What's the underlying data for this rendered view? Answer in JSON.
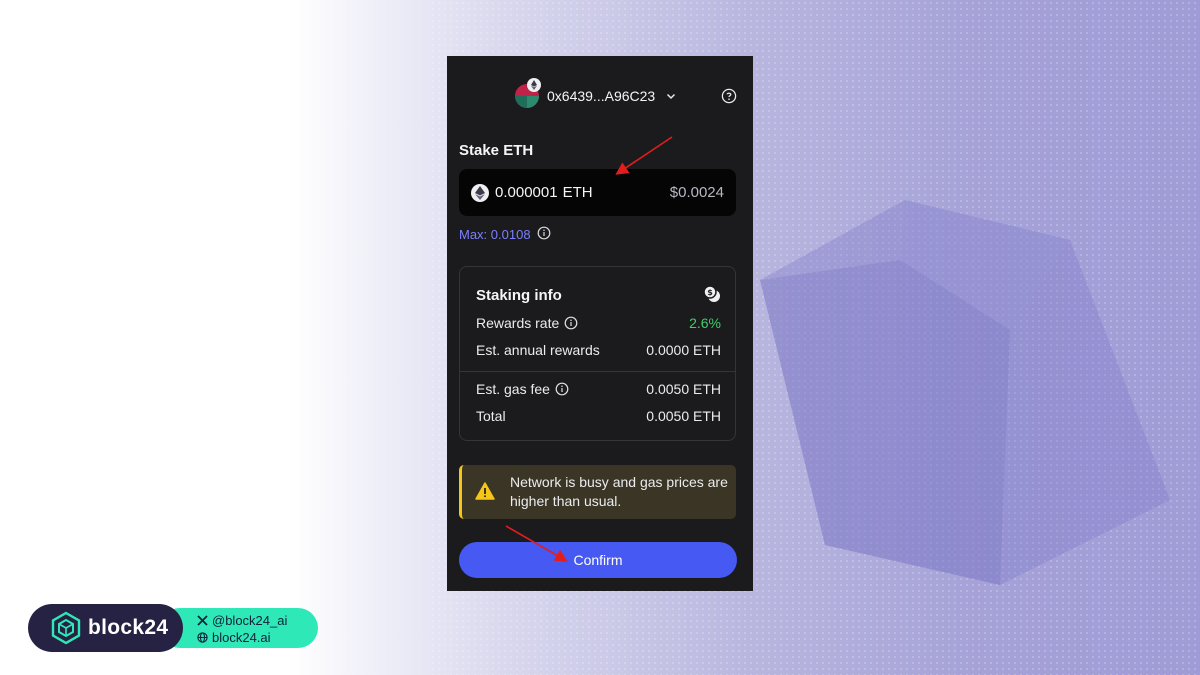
{
  "account": {
    "address": "0x6439...A96C23"
  },
  "stake": {
    "title": "Stake ETH",
    "amount": "0.000001",
    "unit": "ETH",
    "usd_value": "$0.0024",
    "max_label": "Max: 0.0108"
  },
  "staking_info": {
    "title": "Staking info",
    "rows": [
      {
        "label": "Rewards rate",
        "value": "2.6%"
      },
      {
        "label": "Est. annual rewards",
        "value": "0.0000 ETH"
      },
      {
        "label": "Est. gas fee",
        "value": "0.0050 ETH"
      },
      {
        "label": "Total",
        "value": "0.0050 ETH"
      }
    ]
  },
  "warning": {
    "text": "Network is busy and gas prices are higher than usual."
  },
  "confirm_label": "Confirm",
  "branding": {
    "name": "block24",
    "twitter": "@block24_ai",
    "website": "block24.ai"
  },
  "colors": {
    "accent": "#4659f2",
    "max_link": "#7b80ff",
    "positive": "#3fce6a",
    "warning": "#f5c518",
    "brand_mint": "#2ee8b8"
  }
}
